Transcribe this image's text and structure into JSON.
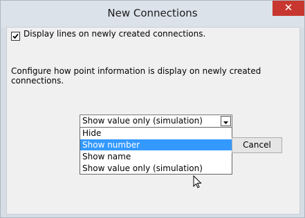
{
  "window": {
    "title": "New Connections",
    "close_glyph": "✕"
  },
  "checkbox": {
    "label": "Display lines on newly created connections.",
    "checked": true
  },
  "description": "Configure how point information is display on newly created connections.",
  "combo": {
    "selected_value": "Show value only (simulation)"
  },
  "dropdown": {
    "options": [
      "Hide",
      "Show number",
      "Show name",
      "Show value only (simulation)"
    ],
    "highlighted_index": 1
  },
  "buttons": {
    "cancel_label": "Cancel"
  },
  "icons": {
    "close": "close-icon",
    "check": "checkmark-icon",
    "dropdown": "chevron-down-icon",
    "cursor": "mouse-pointer-icon"
  },
  "colors": {
    "highlight": "#3399ff",
    "close_button": "#c7372f"
  }
}
